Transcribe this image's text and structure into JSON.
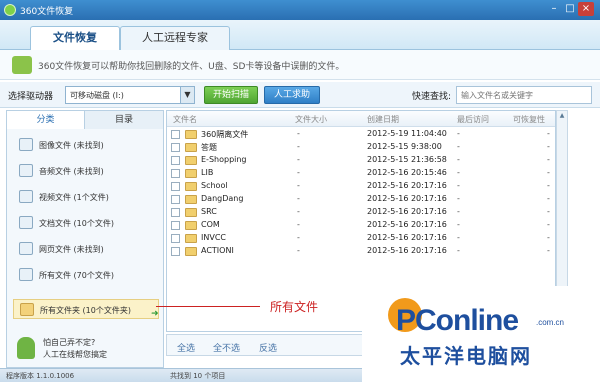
{
  "window": {
    "title": "360文件恢复",
    "min": "–",
    "max": "□",
    "close": "×"
  },
  "tabs": [
    {
      "label": "文件恢复"
    },
    {
      "label": "人工远程专家"
    }
  ],
  "info": {
    "text": "360文件恢复可以帮助你找回删除的文件、U盘、SD卡等设备中误删的文件。"
  },
  "toolbar": {
    "drive_label": "选择驱动器",
    "drive_value": "可移动磁盘 (I:)",
    "scan_button": "开始扫描",
    "manual_button": "人工求助",
    "quick_search_label": "快速查找:",
    "search_placeholder": "输入文件名或关键字"
  },
  "sidebar": {
    "tabs": [
      "分类",
      "目录"
    ],
    "categories": [
      {
        "label": "图像文件 (未找到)"
      },
      {
        "label": "音频文件 (未找到)"
      },
      {
        "label": "视频文件 (1个文件)"
      },
      {
        "label": "文档文件 (10个文件)"
      },
      {
        "label": "网页文件 (未找到)"
      },
      {
        "label": "所有文件 (70个文件)"
      },
      {
        "label": "所有文件夹 (10个文件夹)"
      }
    ],
    "help": {
      "line1": "怕自己弄不定?",
      "line2": "人工在线帮您搞定"
    }
  },
  "list": {
    "columns": [
      "文件名",
      "文件大小",
      "创建日期",
      "最后访问",
      "可恢复性"
    ],
    "rows": [
      {
        "name": "360隔离文件",
        "size": "-",
        "created": "2012-5-19 11:04:40",
        "accessed": "-",
        "recover": "-"
      },
      {
        "name": "答题",
        "size": "-",
        "created": "2012-5-15 9:38:00",
        "accessed": "-",
        "recover": "-"
      },
      {
        "name": "E-Shopping",
        "size": "-",
        "created": "2012-5-15 21:36:58",
        "accessed": "-",
        "recover": "-"
      },
      {
        "name": "LIB",
        "size": "-",
        "created": "2012-5-16 20:15:46",
        "accessed": "-",
        "recover": "-"
      },
      {
        "name": "School",
        "size": "-",
        "created": "2012-5-16 20:17:16",
        "accessed": "-",
        "recover": "-"
      },
      {
        "name": "DangDang",
        "size": "-",
        "created": "2012-5-16 20:17:16",
        "accessed": "-",
        "recover": "-"
      },
      {
        "name": "SRC",
        "size": "-",
        "created": "2012-5-16 20:17:16",
        "accessed": "-",
        "recover": "-"
      },
      {
        "name": "COM",
        "size": "-",
        "created": "2012-5-16 20:17:16",
        "accessed": "-",
        "recover": "-"
      },
      {
        "name": "INVCC",
        "size": "-",
        "created": "2012-5-16 20:17:16",
        "accessed": "-",
        "recover": "-"
      },
      {
        "name": "ACTIONI",
        "size": "-",
        "created": "2012-5-16 20:17:16",
        "accessed": "-",
        "recover": "-"
      }
    ],
    "select_all": "全选",
    "select_none": "全不选",
    "invert": "反选"
  },
  "status": {
    "version": "程序版本 1.1.0.1006",
    "found": "共找到 10 个项目"
  },
  "annotation": {
    "text": "所有文件"
  },
  "watermark": {
    "brand": "PConline",
    "domain": ".com.cn",
    "chinese": "太平洋电脑网"
  }
}
